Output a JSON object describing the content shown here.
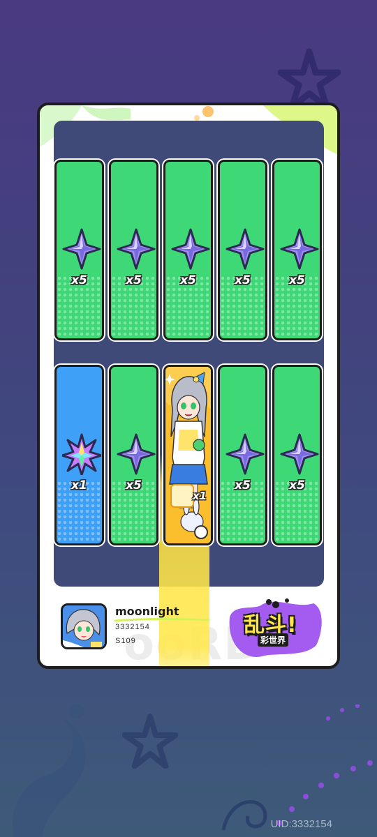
{
  "uid_label": "UID:3332154",
  "grid": {
    "rows": [
      [
        {
          "type": "star-crystal",
          "quantity": "x5",
          "background": "green"
        },
        {
          "type": "star-crystal",
          "quantity": "x5",
          "background": "green"
        },
        {
          "type": "star-crystal",
          "quantity": "x5",
          "background": "green"
        },
        {
          "type": "star-crystal",
          "quantity": "x5",
          "background": "green"
        },
        {
          "type": "star-crystal",
          "quantity": "x5",
          "background": "green"
        }
      ],
      [
        {
          "type": "rainbow-crystal",
          "quantity": "x1",
          "background": "blue"
        },
        {
          "type": "star-crystal",
          "quantity": "x5",
          "background": "green"
        },
        {
          "type": "character-card",
          "quantity": "x1",
          "background": "gold",
          "highlighted": true
        },
        {
          "type": "star-crystal",
          "quantity": "x5",
          "background": "green"
        },
        {
          "type": "star-crystal",
          "quantity": "x5",
          "background": "green"
        }
      ]
    ]
  },
  "player": {
    "name": "moonlight",
    "id": "3332154",
    "server": "S109"
  },
  "logo": {
    "main": "乱斗!",
    "sub": "彩世界"
  },
  "colors": {
    "green_slot": "#3fd877",
    "blue_slot": "#3ea0f7",
    "gold_slot": "#fbbf2e",
    "board": "#3f4a78",
    "highlight_glow": "#ffe13c"
  }
}
